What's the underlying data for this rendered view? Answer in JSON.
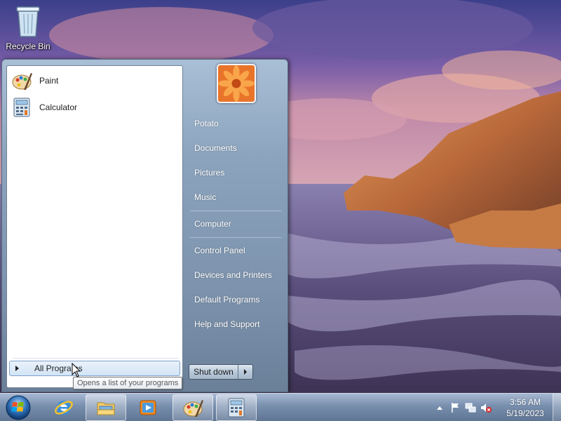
{
  "desktop": {
    "icons": [
      {
        "label": "Recycle Bin",
        "icon": "recycle-bin-icon"
      }
    ]
  },
  "start_menu": {
    "pinned": [
      {
        "label": "Paint",
        "icon": "paint-icon"
      },
      {
        "label": "Calculator",
        "icon": "calculator-icon"
      }
    ],
    "all_programs_label": "All Programs",
    "all_programs_tooltip": "Opens a list of your programs",
    "user_picture_icon": "flower-user-picture",
    "right_items": [
      "Potato",
      "Documents",
      "Pictures",
      "Music",
      "Computer",
      "Control Panel",
      "Devices and Printers",
      "Default Programs",
      "Help and Support"
    ],
    "shutdown_label": "Shut down"
  },
  "taskbar": {
    "start_icon": "windows-orb-icon",
    "pinned": [
      {
        "icon": "internet-explorer-icon",
        "active": false
      },
      {
        "icon": "file-explorer-icon",
        "active": true
      },
      {
        "icon": "media-player-icon",
        "active": false
      },
      {
        "icon": "paint-icon",
        "active": true
      },
      {
        "icon": "calculator-icon",
        "active": true
      }
    ],
    "tray_icons": [
      "show-hidden-icons-icon",
      "action-center-flag-icon",
      "network-icon",
      "volume-muted-icon"
    ],
    "time": "3:56 AM",
    "date": "5/19/2023"
  },
  "colors": {
    "menu_accent": "#8ba3bd",
    "taskbar": "#7891af",
    "hover_highlight": "#d2e4f6"
  }
}
